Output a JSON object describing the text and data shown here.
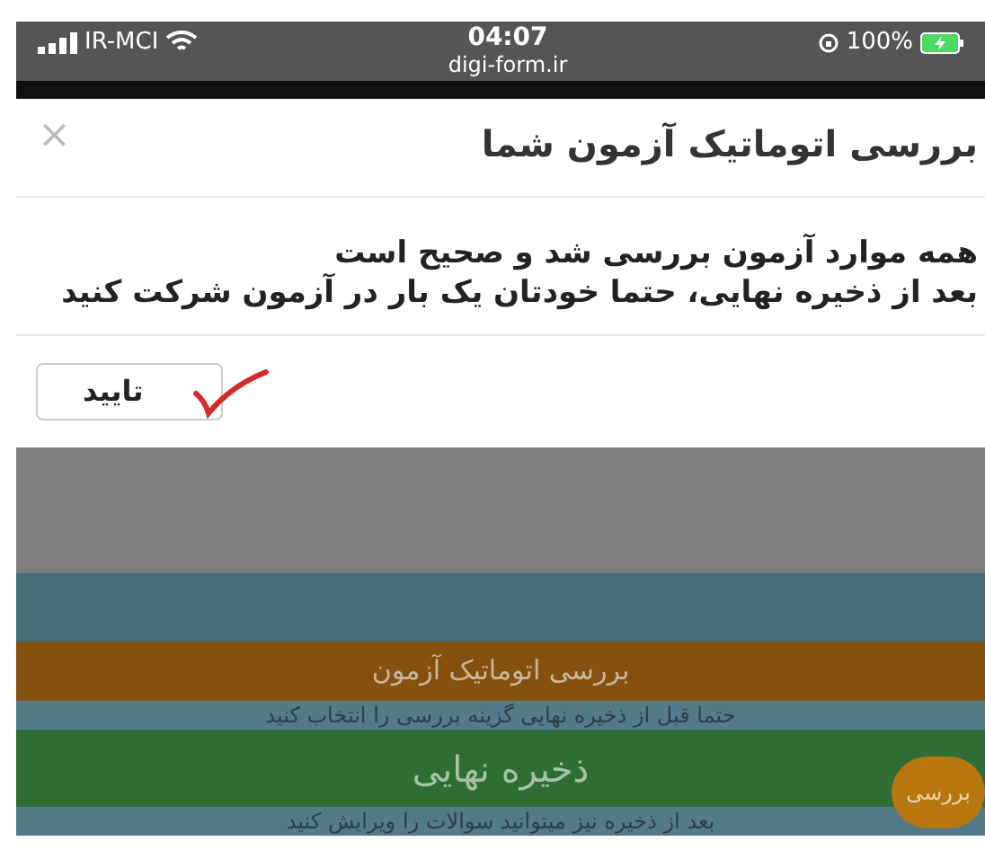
{
  "status_bar": {
    "carrier": "IR-MCI",
    "time": "04:07",
    "url": "digi-form.ir",
    "battery": "100%"
  },
  "dialog": {
    "title": "بررسی اتوماتیک آزمون شما",
    "close": "×",
    "message_lines": [
      "همه موارد آزمون بررسی شد و صحیح است",
      "بعد از ذخیره نهایی، حتما خودتان یک بار در آزمون شرکت کنید"
    ],
    "confirm": "تایید"
  },
  "page": {
    "review_button": "بررسی اتوماتیک آزمون",
    "review_hint": "حتما قبل از ذخیره نهایی گزینه بررسی را انتخاب کنید",
    "save_button": "ذخیره نهایی",
    "save_hint": "بعد از ذخیره نیز میتوانید سوالات را ویرایش کنید",
    "fab": "بررسی"
  }
}
